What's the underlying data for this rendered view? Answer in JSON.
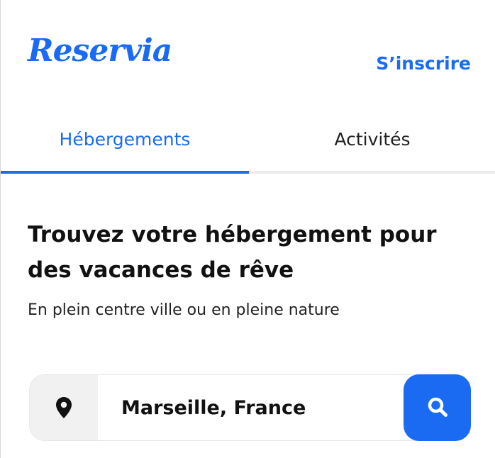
{
  "header": {
    "logo_text": "Reservia",
    "signup_label": "S’inscrire"
  },
  "tabs": [
    {
      "label": "Hébergements",
      "active": true
    },
    {
      "label": "Activités",
      "active": false
    }
  ],
  "hero": {
    "title": "Trouvez votre hébergement pour des vacances de rêve",
    "subtitle": "En plein centre ville ou en pleine nature"
  },
  "search": {
    "location_value": "Marseille, France",
    "location_icon": "location-pin-icon",
    "search_icon": "search-icon"
  },
  "colors": {
    "accent": "#1a6bf2",
    "text": "#111111",
    "input_icon_bg": "#f1f1f1"
  }
}
